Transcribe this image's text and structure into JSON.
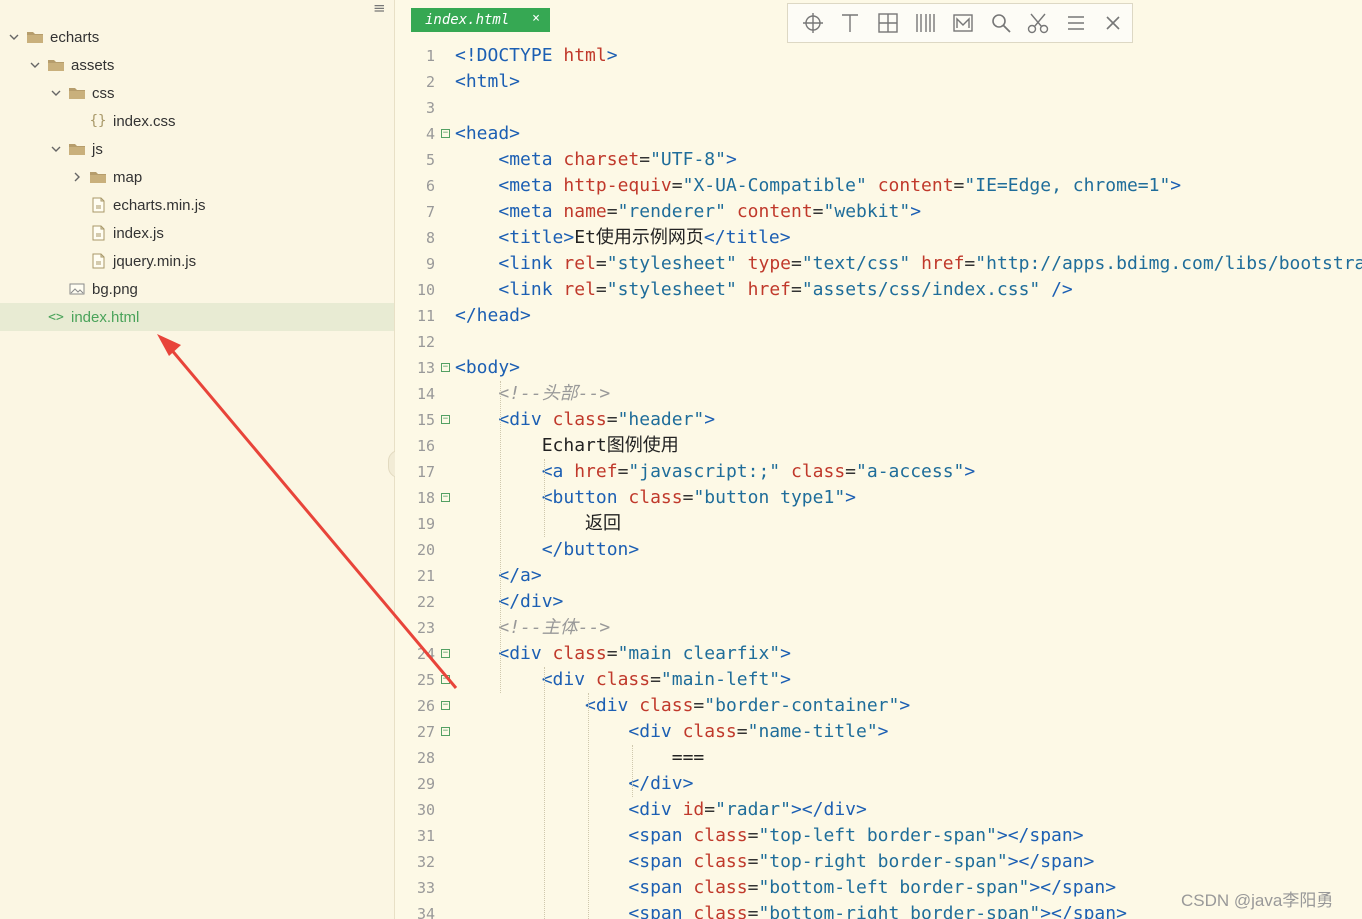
{
  "sidebar": {
    "items": [
      {
        "label": "echarts",
        "type": "folder",
        "depth": 0,
        "open": true
      },
      {
        "label": "assets",
        "type": "folder",
        "depth": 1,
        "open": true
      },
      {
        "label": "css",
        "type": "folder",
        "depth": 2,
        "open": true
      },
      {
        "label": "index.css",
        "type": "css",
        "depth": 3
      },
      {
        "label": "js",
        "type": "folder",
        "depth": 2,
        "open": true
      },
      {
        "label": "map",
        "type": "folder",
        "depth": 3,
        "open": false
      },
      {
        "label": "echarts.min.js",
        "type": "file",
        "depth": 3
      },
      {
        "label": "index.js",
        "type": "file",
        "depth": 3
      },
      {
        "label": "jquery.min.js",
        "type": "file",
        "depth": 3
      },
      {
        "label": "bg.png",
        "type": "image",
        "depth": 2
      },
      {
        "label": "index.html",
        "type": "html",
        "depth": 1,
        "selected": true
      }
    ]
  },
  "editor": {
    "tab": {
      "label": "index.html",
      "close": "×"
    },
    "toolbar": [
      "crosshair-icon",
      "text-cursor-icon",
      "grid-icon",
      "columns-icon",
      "markdown-icon",
      "search-icon",
      "scissors-icon",
      "menu-icon",
      "close-icon"
    ],
    "lines": [
      {
        "n": "1",
        "fold": false,
        "tokens": [
          [
            "tag",
            "<!DOCTYPE "
          ],
          [
            "attr",
            "html"
          ],
          [
            "tag",
            ">"
          ]
        ]
      },
      {
        "n": "2",
        "fold": false,
        "tokens": [
          [
            "tag",
            "<html>"
          ]
        ]
      },
      {
        "n": "3",
        "fold": false,
        "tokens": []
      },
      {
        "n": "4",
        "fold": true,
        "tokens": [
          [
            "tag",
            "<head>"
          ]
        ]
      },
      {
        "n": "5",
        "fold": false,
        "tokens": [
          [
            "text",
            "    "
          ],
          [
            "tag",
            "<meta "
          ],
          [
            "attr",
            "charset"
          ],
          [
            "eq",
            "="
          ],
          [
            "str",
            "\"UTF-8\""
          ],
          [
            "tag",
            ">"
          ]
        ]
      },
      {
        "n": "6",
        "fold": false,
        "tokens": [
          [
            "text",
            "    "
          ],
          [
            "tag",
            "<meta "
          ],
          [
            "attr",
            "http-equiv"
          ],
          [
            "eq",
            "="
          ],
          [
            "str",
            "\"X-UA-Compatible\" "
          ],
          [
            "attr",
            "content"
          ],
          [
            "eq",
            "="
          ],
          [
            "str",
            "\"IE=Edge, chrome=1\""
          ],
          [
            "tag",
            ">"
          ]
        ]
      },
      {
        "n": "7",
        "fold": false,
        "tokens": [
          [
            "text",
            "    "
          ],
          [
            "tag",
            "<meta "
          ],
          [
            "attr",
            "name"
          ],
          [
            "eq",
            "="
          ],
          [
            "str",
            "\"renderer\" "
          ],
          [
            "attr",
            "content"
          ],
          [
            "eq",
            "="
          ],
          [
            "str",
            "\"webkit\""
          ],
          [
            "tag",
            ">"
          ]
        ]
      },
      {
        "n": "8",
        "fold": false,
        "tokens": [
          [
            "text",
            "    "
          ],
          [
            "tag",
            "<title>"
          ],
          [
            "text",
            "Et使用示例网页"
          ],
          [
            "tag",
            "</title>"
          ]
        ]
      },
      {
        "n": "9",
        "fold": false,
        "tokens": [
          [
            "text",
            "    "
          ],
          [
            "tag",
            "<link "
          ],
          [
            "attr",
            "rel"
          ],
          [
            "eq",
            "="
          ],
          [
            "str",
            "\"stylesheet\" "
          ],
          [
            "attr",
            "type"
          ],
          [
            "eq",
            "="
          ],
          [
            "str",
            "\"text/css\" "
          ],
          [
            "attr",
            "href"
          ],
          [
            "eq",
            "="
          ],
          [
            "str",
            "\"http://apps.bdimg.com/libs/bootstrap"
          ]
        ]
      },
      {
        "n": "10",
        "fold": false,
        "tokens": [
          [
            "text",
            "    "
          ],
          [
            "tag",
            "<link "
          ],
          [
            "attr",
            "rel"
          ],
          [
            "eq",
            "="
          ],
          [
            "str",
            "\"stylesheet\" "
          ],
          [
            "attr",
            "href"
          ],
          [
            "eq",
            "="
          ],
          [
            "str",
            "\"assets/css/index.css\" "
          ],
          [
            "tag",
            "/>"
          ]
        ]
      },
      {
        "n": "11",
        "fold": false,
        "tokens": [
          [
            "tag",
            "</head>"
          ]
        ]
      },
      {
        "n": "12",
        "fold": false,
        "tokens": []
      },
      {
        "n": "13",
        "fold": true,
        "tokens": [
          [
            "tag",
            "<body>"
          ]
        ]
      },
      {
        "n": "14",
        "fold": false,
        "tokens": [
          [
            "text",
            "    "
          ],
          [
            "com",
            "<!--头部-->"
          ]
        ]
      },
      {
        "n": "15",
        "fold": true,
        "tokens": [
          [
            "text",
            "    "
          ],
          [
            "tag",
            "<div "
          ],
          [
            "attr",
            "class"
          ],
          [
            "eq",
            "="
          ],
          [
            "str",
            "\"header\""
          ],
          [
            "tag",
            ">"
          ]
        ]
      },
      {
        "n": "16",
        "fold": false,
        "tokens": [
          [
            "text",
            "        Echart图例使用"
          ]
        ]
      },
      {
        "n": "17",
        "fold": false,
        "tokens": [
          [
            "text",
            "        "
          ],
          [
            "tag",
            "<a "
          ],
          [
            "attr",
            "href"
          ],
          [
            "eq",
            "="
          ],
          [
            "str",
            "\"javascript:;\" "
          ],
          [
            "attr",
            "class"
          ],
          [
            "eq",
            "="
          ],
          [
            "str",
            "\"a-access\""
          ],
          [
            "tag",
            ">"
          ]
        ]
      },
      {
        "n": "18",
        "fold": true,
        "tokens": [
          [
            "text",
            "        "
          ],
          [
            "tag",
            "<button "
          ],
          [
            "attr",
            "class"
          ],
          [
            "eq",
            "="
          ],
          [
            "str",
            "\"button type1\""
          ],
          [
            "tag",
            ">"
          ]
        ]
      },
      {
        "n": "19",
        "fold": false,
        "tokens": [
          [
            "text",
            "            返回"
          ]
        ]
      },
      {
        "n": "20",
        "fold": false,
        "tokens": [
          [
            "text",
            "        "
          ],
          [
            "tag",
            "</button>"
          ]
        ]
      },
      {
        "n": "21",
        "fold": false,
        "tokens": [
          [
            "text",
            "    "
          ],
          [
            "tag",
            "</a>"
          ]
        ]
      },
      {
        "n": "22",
        "fold": false,
        "tokens": [
          [
            "text",
            "    "
          ],
          [
            "tag",
            "</div>"
          ]
        ]
      },
      {
        "n": "23",
        "fold": false,
        "tokens": [
          [
            "text",
            "    "
          ],
          [
            "com",
            "<!--主体-->"
          ]
        ]
      },
      {
        "n": "24",
        "fold": true,
        "tokens": [
          [
            "text",
            "    "
          ],
          [
            "tag",
            "<div "
          ],
          [
            "attr",
            "class"
          ],
          [
            "eq",
            "="
          ],
          [
            "str",
            "\"main clearfix\""
          ],
          [
            "tag",
            ">"
          ]
        ]
      },
      {
        "n": "25",
        "fold": true,
        "tokens": [
          [
            "text",
            "        "
          ],
          [
            "tag",
            "<div "
          ],
          [
            "attr",
            "class"
          ],
          [
            "eq",
            "="
          ],
          [
            "str",
            "\"main-left\""
          ],
          [
            "tag",
            ">"
          ]
        ]
      },
      {
        "n": "26",
        "fold": true,
        "tokens": [
          [
            "text",
            "            "
          ],
          [
            "tag",
            "<div "
          ],
          [
            "attr",
            "class"
          ],
          [
            "eq",
            "="
          ],
          [
            "str",
            "\"border-container\""
          ],
          [
            "tag",
            ">"
          ]
        ]
      },
      {
        "n": "27",
        "fold": true,
        "tokens": [
          [
            "text",
            "                "
          ],
          [
            "tag",
            "<div "
          ],
          [
            "attr",
            "class"
          ],
          [
            "eq",
            "="
          ],
          [
            "str",
            "\"name-title\""
          ],
          [
            "tag",
            ">"
          ]
        ]
      },
      {
        "n": "28",
        "fold": false,
        "tokens": [
          [
            "text",
            "                    ==="
          ]
        ]
      },
      {
        "n": "29",
        "fold": false,
        "tokens": [
          [
            "text",
            "                "
          ],
          [
            "tag",
            "</div>"
          ]
        ]
      },
      {
        "n": "30",
        "fold": false,
        "tokens": [
          [
            "text",
            "                "
          ],
          [
            "tag",
            "<div "
          ],
          [
            "attr",
            "id"
          ],
          [
            "eq",
            "="
          ],
          [
            "str",
            "\"radar\""
          ],
          [
            "tag",
            "></div>"
          ]
        ]
      },
      {
        "n": "31",
        "fold": false,
        "tokens": [
          [
            "text",
            "                "
          ],
          [
            "tag",
            "<span "
          ],
          [
            "attr",
            "class"
          ],
          [
            "eq",
            "="
          ],
          [
            "str",
            "\"top-left border-span\""
          ],
          [
            "tag",
            "></span>"
          ]
        ]
      },
      {
        "n": "32",
        "fold": false,
        "tokens": [
          [
            "text",
            "                "
          ],
          [
            "tag",
            "<span "
          ],
          [
            "attr",
            "class"
          ],
          [
            "eq",
            "="
          ],
          [
            "str",
            "\"top-right border-span\""
          ],
          [
            "tag",
            "></span>"
          ]
        ]
      },
      {
        "n": "33",
        "fold": false,
        "tokens": [
          [
            "text",
            "                "
          ],
          [
            "tag",
            "<span "
          ],
          [
            "attr",
            "class"
          ],
          [
            "eq",
            "="
          ],
          [
            "str",
            "\"bottom-left border-span\""
          ],
          [
            "tag",
            "></span>"
          ]
        ]
      },
      {
        "n": "34",
        "fold": false,
        "tokens": [
          [
            "text",
            "                "
          ],
          [
            "tag",
            "<span "
          ],
          [
            "attr",
            "class"
          ],
          [
            "eq",
            "="
          ],
          [
            "str",
            "\"bottom-right border-span\""
          ],
          [
            "tag",
            "></span>"
          ]
        ]
      }
    ]
  },
  "watermark": "CSDN @java李阳勇",
  "colors": {
    "accent": "#36a853",
    "arrow": "#e8443a",
    "tag": "#1c5fb3",
    "attr": "#c0392b",
    "string": "#1f6d9a"
  }
}
